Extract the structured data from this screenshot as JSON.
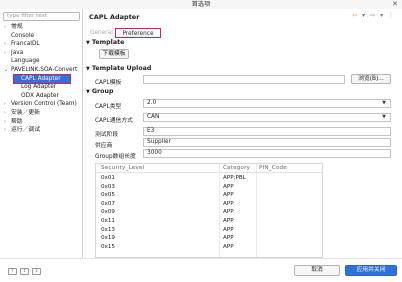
{
  "window": {
    "title": "首选项",
    "close_glyph": "✕"
  },
  "sidebar": {
    "filter_placeholder": "type filter text",
    "items": [
      {
        "label": "常规",
        "arrow": "›",
        "level": 0
      },
      {
        "label": "Console",
        "arrow": "",
        "level": 0
      },
      {
        "label": "FrancaIDL",
        "arrow": "›",
        "level": 0
      },
      {
        "label": "Java",
        "arrow": "›",
        "level": 0
      },
      {
        "label": "Language",
        "arrow": "",
        "level": 0
      },
      {
        "label": "PAVELINK.SOA-Convert",
        "arrow": "⌄",
        "level": 0
      },
      {
        "label": "CAPL Adapter",
        "arrow": "",
        "level": 1,
        "selected": true
      },
      {
        "label": "Log Adapter",
        "arrow": "",
        "level": 1
      },
      {
        "label": "ODX Adapter",
        "arrow": "",
        "level": 1
      },
      {
        "label": "Version Control (Team)",
        "arrow": "›",
        "level": 0
      },
      {
        "label": "安装／更新",
        "arrow": "›",
        "level": 0
      },
      {
        "label": "帮助",
        "arrow": "›",
        "level": 0
      },
      {
        "label": "运行／调试",
        "arrow": "›",
        "level": 0
      }
    ]
  },
  "main": {
    "title": "CAPL Adapter",
    "tabs": [
      {
        "label": "General"
      },
      {
        "label": "Preference"
      }
    ],
    "template": {
      "header": "Template",
      "download_button": "下载模板"
    },
    "template_upload": {
      "header": "Template Upload",
      "capl_label": "CAPL模板",
      "capl_value": "",
      "browse_button": "浏览(B)..."
    },
    "group": {
      "header": "Group",
      "capl_type_label": "CAPL类型",
      "capl_type_value": "2.0",
      "capl_comm_label": "CAPL通信方式",
      "capl_comm_value": "CAN",
      "test_stage_label": "测试阶段",
      "test_stage_value": "E3",
      "supplier_label": "供应商",
      "supplier_value": "Supplier",
      "group_len_label": "Group数组长度",
      "group_len_value": "3000"
    },
    "security_table": {
      "columns": [
        "Security_Level",
        "Category",
        "PIN_Code"
      ],
      "rows": [
        [
          "0x01",
          "APP;PBL",
          ""
        ],
        [
          "0x03",
          "APP",
          ""
        ],
        [
          "0x05",
          "APP",
          ""
        ],
        [
          "0x07",
          "APP",
          ""
        ],
        [
          "0x09",
          "APP",
          ""
        ],
        [
          "0x11",
          "APP",
          ""
        ],
        [
          "0x13",
          "APP",
          ""
        ],
        [
          "0x19",
          "APP",
          ""
        ],
        [
          "0x15",
          "APP",
          ""
        ]
      ]
    }
  },
  "footer": {
    "cancel_button": "取消",
    "apply_close_button": "应用并关闭"
  },
  "colors": {
    "accent": "#2f73d8",
    "highlight_border": "#d81b60",
    "nav_orange": "#e08a00"
  }
}
